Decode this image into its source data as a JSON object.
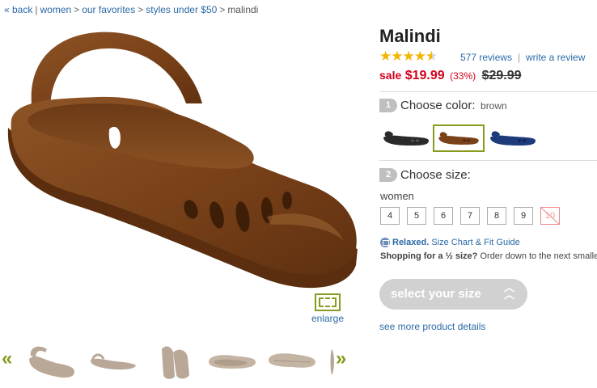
{
  "breadcrumb": {
    "back": "« back",
    "items": [
      "women",
      "our favorites",
      "styles under $50"
    ],
    "current": "malindi"
  },
  "gallery": {
    "enlarge_label": "enlarge",
    "prev_arrow": "«",
    "next_arrow": "»"
  },
  "product": {
    "name": "Malindi",
    "rating": 4.5,
    "reviews_label": "577 reviews",
    "write_review_label": "write a review",
    "sale_label": "sale",
    "sale_price": "$19.99",
    "discount": "(33%)",
    "original_price": "$29.99"
  },
  "color_step": {
    "number": "1",
    "title": "Choose color:",
    "selected_value": "brown",
    "swatches": [
      "black",
      "brown",
      "navy"
    ],
    "selected": "brown"
  },
  "size_step": {
    "number": "2",
    "title": "Choose size:",
    "gender": "women",
    "sizes": [
      "4",
      "5",
      "6",
      "7",
      "8",
      "9",
      "10"
    ],
    "unavailable": [
      "10"
    ]
  },
  "fit": {
    "relaxed": "Relaxed.",
    "guide_link": "Size Chart & Fit Guide",
    "half_size_bold": "Shopping for a ½ size?",
    "half_size_text": "Order down to the next smaller"
  },
  "actions": {
    "select_size": "select your size",
    "details_link": "see more product details"
  },
  "colors": {
    "brown": "#7a4219",
    "black": "#2a2a2a",
    "navy": "#1d3a7a",
    "accent": "#8a9a1e",
    "link": "#2b6aa6",
    "sale": "#d0021b"
  }
}
